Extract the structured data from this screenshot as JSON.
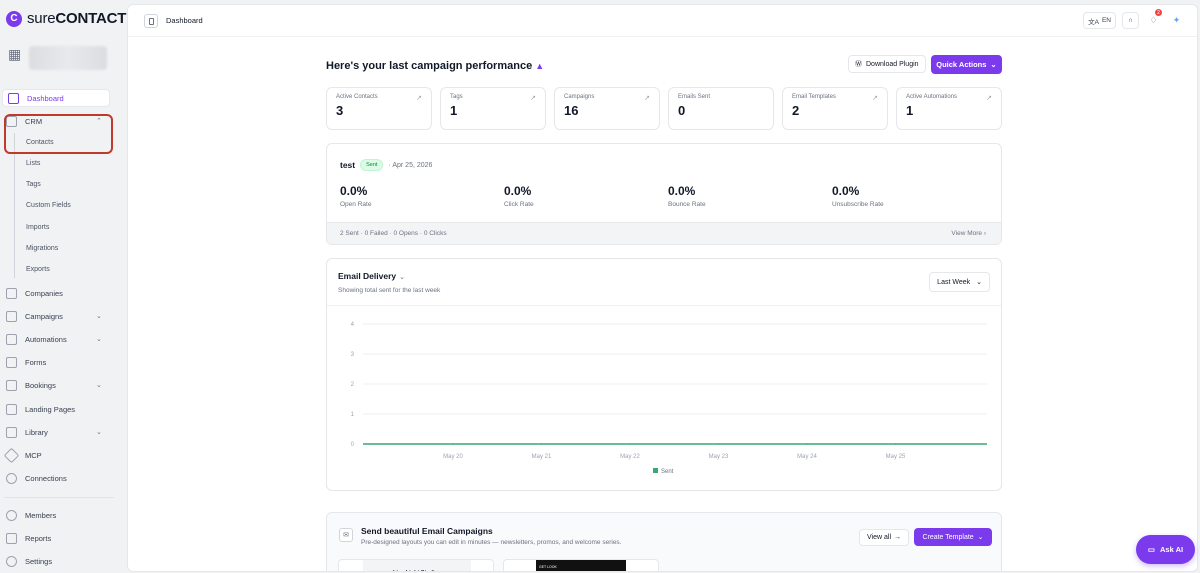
{
  "brand": {
    "prefix": "sure",
    "suffix": "CONTACT"
  },
  "sidebar": {
    "items": [
      {
        "label": "Dashboard"
      },
      {
        "label": "CRM"
      },
      {
        "label": "Companies"
      },
      {
        "label": "Campaigns"
      },
      {
        "label": "Automations"
      },
      {
        "label": "Forms"
      },
      {
        "label": "Bookings"
      },
      {
        "label": "Landing Pages"
      },
      {
        "label": "Library"
      },
      {
        "label": "MCP"
      },
      {
        "label": "Connections"
      },
      {
        "label": "Members"
      },
      {
        "label": "Reports"
      },
      {
        "label": "Settings"
      }
    ],
    "crm_subitems": [
      {
        "label": "Contacts"
      },
      {
        "label": "Lists"
      },
      {
        "label": "Tags"
      },
      {
        "label": "Custom Fields"
      },
      {
        "label": "Imports"
      },
      {
        "label": "Migrations"
      },
      {
        "label": "Exports"
      }
    ]
  },
  "topbar": {
    "breadcrumb": "Dashboard",
    "language": "EN",
    "notification_count": "2"
  },
  "dashboard": {
    "heading": "Here's your last campaign performance",
    "download_plugin": "Download Plugin",
    "quick_actions": "Quick Actions",
    "stats": [
      {
        "label": "Active Contacts",
        "value": "3"
      },
      {
        "label": "Tags",
        "value": "1"
      },
      {
        "label": "Campaigns",
        "value": "16"
      },
      {
        "label": "Emails Sent",
        "value": "0"
      },
      {
        "label": "Email Templates",
        "value": "2"
      },
      {
        "label": "Active Automations",
        "value": "1"
      }
    ]
  },
  "campaign": {
    "name": "test",
    "status": "Sent",
    "date": "· Apr 25, 2026",
    "metrics": [
      {
        "value": "0.0%",
        "label": "Open Rate"
      },
      {
        "value": "0.0%",
        "label": "Click Rate"
      },
      {
        "value": "0.0%",
        "label": "Bounce Rate"
      },
      {
        "value": "0.0%",
        "label": "Unsubscribe Rate"
      }
    ],
    "summary": "2 Sent · 0 Failed · 0 Opens · 0 Clicks",
    "view_more": "View More"
  },
  "delivery": {
    "title": "Email Delivery",
    "subtitle": "Showing total sent for the last week",
    "period": "Last Week"
  },
  "chart_data": {
    "type": "line",
    "x": [
      "May 20",
      "May 21",
      "May 22",
      "May 23",
      "May 24",
      "May 25"
    ],
    "series": [
      {
        "name": "Sent",
        "values": [
          0,
          0,
          0,
          0,
          0,
          0
        ]
      }
    ],
    "yticks": [
      "0",
      "1",
      "2",
      "3",
      "4"
    ],
    "ylim": [
      0,
      4
    ],
    "color": "#3aa776",
    "legend": "bottom",
    "grid": true
  },
  "promo": {
    "title": "Send beautiful Email Campaigns",
    "subtitle": "Pre-designed layouts you can edit in minutes — newsletters, promos, and welcome series.",
    "view_all": "View all",
    "create_template": "Create Template",
    "thumb1_text": "LimeLight Studios",
    "thumb2_text": "GET LOOK"
  },
  "ask_ai": "Ask AI",
  "colors": {
    "accent": "#7c3aed",
    "annotation": "#c0392b",
    "success": "#15803d"
  },
  "icons": [
    "building-icon",
    "grid-icon",
    "crm-icon",
    "arrow-up-right-icon",
    "chevron-down-icon",
    "chat-icon",
    "bell-icon",
    "headset-icon",
    "translate-icon"
  ]
}
